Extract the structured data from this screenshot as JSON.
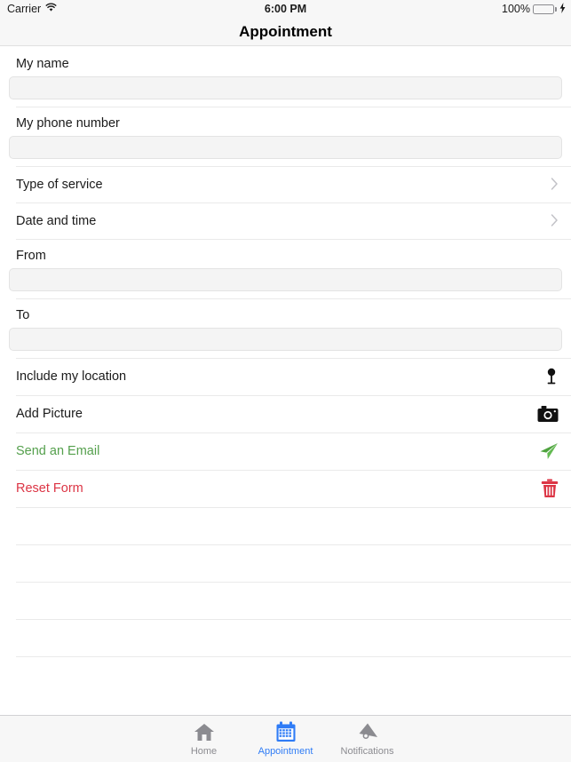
{
  "status_bar": {
    "carrier": "Carrier",
    "wifi_icon": "wifi-icon",
    "time": "6:00 PM",
    "battery_percent": "100%",
    "battery_icon": "battery-full-icon",
    "charging_icon": "lightning-bolt-icon",
    "battery_color": "#4cd964"
  },
  "nav": {
    "title": "Appointment"
  },
  "form": {
    "fields": [
      {
        "label": "My name",
        "value": "",
        "placeholder": "",
        "name": "my-name"
      },
      {
        "label": "My phone number",
        "value": "",
        "placeholder": "",
        "name": "my-phone-number"
      }
    ],
    "nav_rows": [
      {
        "label": "Type of service",
        "icon": "chevron-right-icon",
        "name": "type-of-service"
      },
      {
        "label": "Date and time",
        "icon": "chevron-right-icon",
        "name": "date-and-time"
      }
    ],
    "range_fields": [
      {
        "label": "From",
        "value": "",
        "placeholder": "",
        "name": "from"
      },
      {
        "label": "To",
        "value": "",
        "placeholder": "",
        "name": "to"
      }
    ],
    "actions": [
      {
        "label": "Include my location",
        "icon": "map-pin-icon",
        "color": "#1a1a1a",
        "name": "include-my-location"
      },
      {
        "label": "Add Picture",
        "icon": "camera-icon",
        "color": "#1a1a1a",
        "name": "add-picture"
      },
      {
        "label": "Send an Email",
        "icon": "paper-plane-icon",
        "color": "#55a04d",
        "name": "send-an-email"
      },
      {
        "label": "Reset Form",
        "icon": "trash-icon",
        "color": "#dc3545",
        "name": "reset-form"
      }
    ],
    "empty_row_count": 5
  },
  "tabbar": {
    "items": [
      {
        "label": "Home",
        "icon": "home-icon",
        "active": false
      },
      {
        "label": "Appointment",
        "icon": "calendar-icon",
        "active": true
      },
      {
        "label": "Notifications",
        "icon": "megaphone-icon",
        "active": false
      }
    ],
    "active_color": "#2f7cf6",
    "inactive_color": "#8b8b90"
  }
}
